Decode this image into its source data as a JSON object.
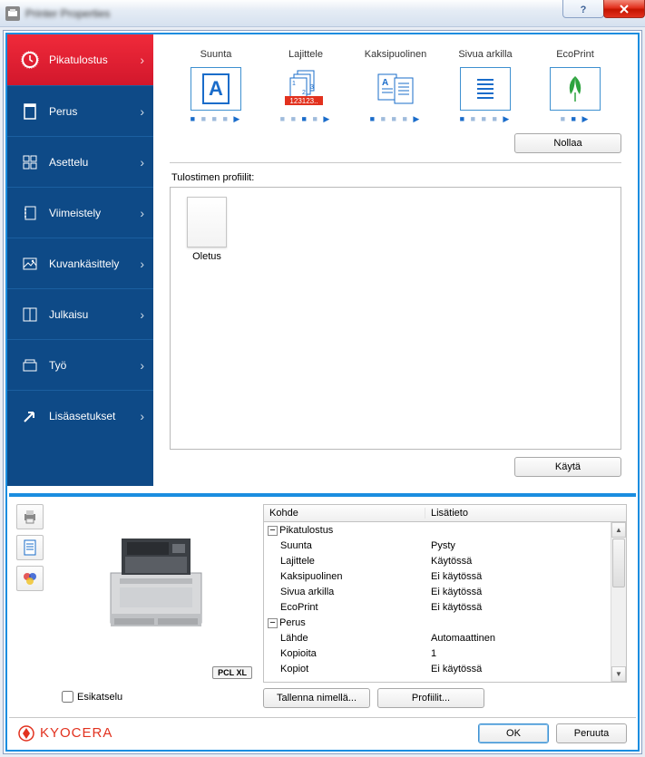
{
  "window": {
    "title": "Printer Properties"
  },
  "sidebar": {
    "items": [
      {
        "label": "Pikatulostus",
        "icon": "clock"
      },
      {
        "label": "Perus",
        "icon": "page"
      },
      {
        "label": "Asettelu",
        "icon": "grid"
      },
      {
        "label": "Viimeistely",
        "icon": "binder"
      },
      {
        "label": "Kuvankäsittely",
        "icon": "image"
      },
      {
        "label": "Julkaisu",
        "icon": "book"
      },
      {
        "label": "Työ",
        "icon": "job"
      },
      {
        "label": "Lisäasetukset",
        "icon": "arrow"
      }
    ]
  },
  "quick": {
    "items": [
      {
        "label": "Suunta"
      },
      {
        "label": "Lajittele"
      },
      {
        "label": "Kaksipuolinen"
      },
      {
        "label": "Sivua arkilla"
      },
      {
        "label": "EcoPrint"
      }
    ],
    "reset": "Nollaa"
  },
  "profiles": {
    "label": "Tulostimen profiilit:",
    "items": [
      {
        "name": "Oletus"
      }
    ],
    "apply": "Käytä"
  },
  "preview": {
    "badge": "PCL XL",
    "checkbox": "Esikatselu"
  },
  "settings": {
    "columns": {
      "key": "Kohde",
      "value": "Lisätieto"
    },
    "groups": [
      {
        "name": "Pikatulostus",
        "rows": [
          {
            "k": "Suunta",
            "v": "Pysty"
          },
          {
            "k": "Lajittele",
            "v": "Käytössä"
          },
          {
            "k": "Kaksipuolinen",
            "v": "Ei käytössä"
          },
          {
            "k": "Sivua arkilla",
            "v": "Ei käytössä"
          },
          {
            "k": "EcoPrint",
            "v": "Ei käytössä"
          }
        ]
      },
      {
        "name": "Perus",
        "rows": [
          {
            "k": "Lähde",
            "v": "Automaattinen"
          },
          {
            "k": "Kopioita",
            "v": "1"
          },
          {
            "k": "Kopiot",
            "v": "Ei käytössä"
          }
        ]
      }
    ],
    "buttons": {
      "save": "Tallenna nimellä...",
      "profiles": "Profiilit..."
    }
  },
  "footer": {
    "brand": "KYOCERA",
    "ok": "OK",
    "cancel": "Peruuta"
  }
}
